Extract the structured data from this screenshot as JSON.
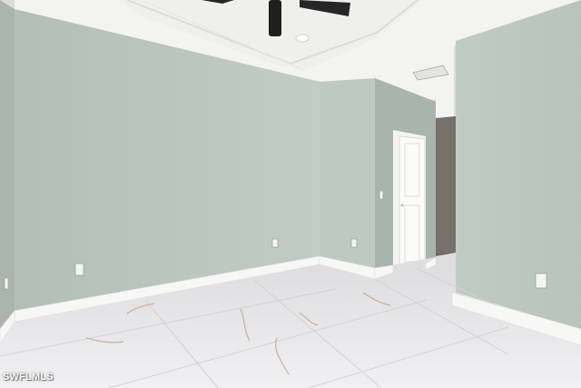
{
  "photo": {
    "subject": "empty-room-interior",
    "watermark": "SWFLMLS"
  },
  "palette": {
    "wall_main": "#bcc7c1",
    "wall_shadow": "#a9b5ae",
    "ceiling": "#f2f2f0",
    "baseboard": "#f7f7f5",
    "floor": "#e7e7e9",
    "floor_vein": "#c9a98d",
    "fan": "#222222"
  }
}
